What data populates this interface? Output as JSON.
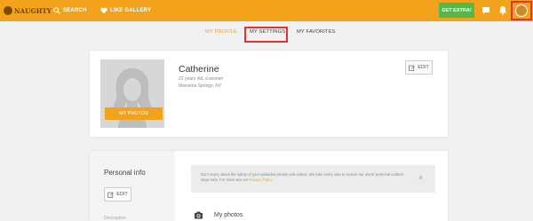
{
  "header": {
    "logo_text": "NAUGHTY",
    "nav": [
      {
        "label": "SEARCH",
        "icon": "search-icon"
      },
      {
        "label": "LIKE GALLERY",
        "icon": "heart-icon"
      }
    ],
    "extra_button": "GET EXTRA!",
    "icons": [
      "chat-icon",
      "bell-icon",
      "avatar"
    ],
    "colors": {
      "brand": "#f3a21b",
      "extra": "#55b84a",
      "highlight": "#e23237"
    }
  },
  "tabs": [
    {
      "label": "MY PROFILE",
      "active": true
    },
    {
      "label": "MY SETTINGS",
      "highlighted": true
    },
    {
      "label": "MY FAVORITES"
    }
  ],
  "profile": {
    "name": "Catherine",
    "age_line": "22 years old, a woman",
    "location": "Massena Springs, NY",
    "photos_button": "MY PHOTOS",
    "edit_label": "EDIT"
  },
  "personal": {
    "title": "Personal info",
    "edit_label": "EDIT",
    "cut_text": "Description"
  },
  "notice": {
    "text": "Don't worry about the safety of your uploaded photos and videos. We take every care to ensure our users' personal content stays safe. For more see our ",
    "link": "Privacy Policy",
    "close": "×"
  },
  "photos_section": {
    "title": "My photos"
  }
}
